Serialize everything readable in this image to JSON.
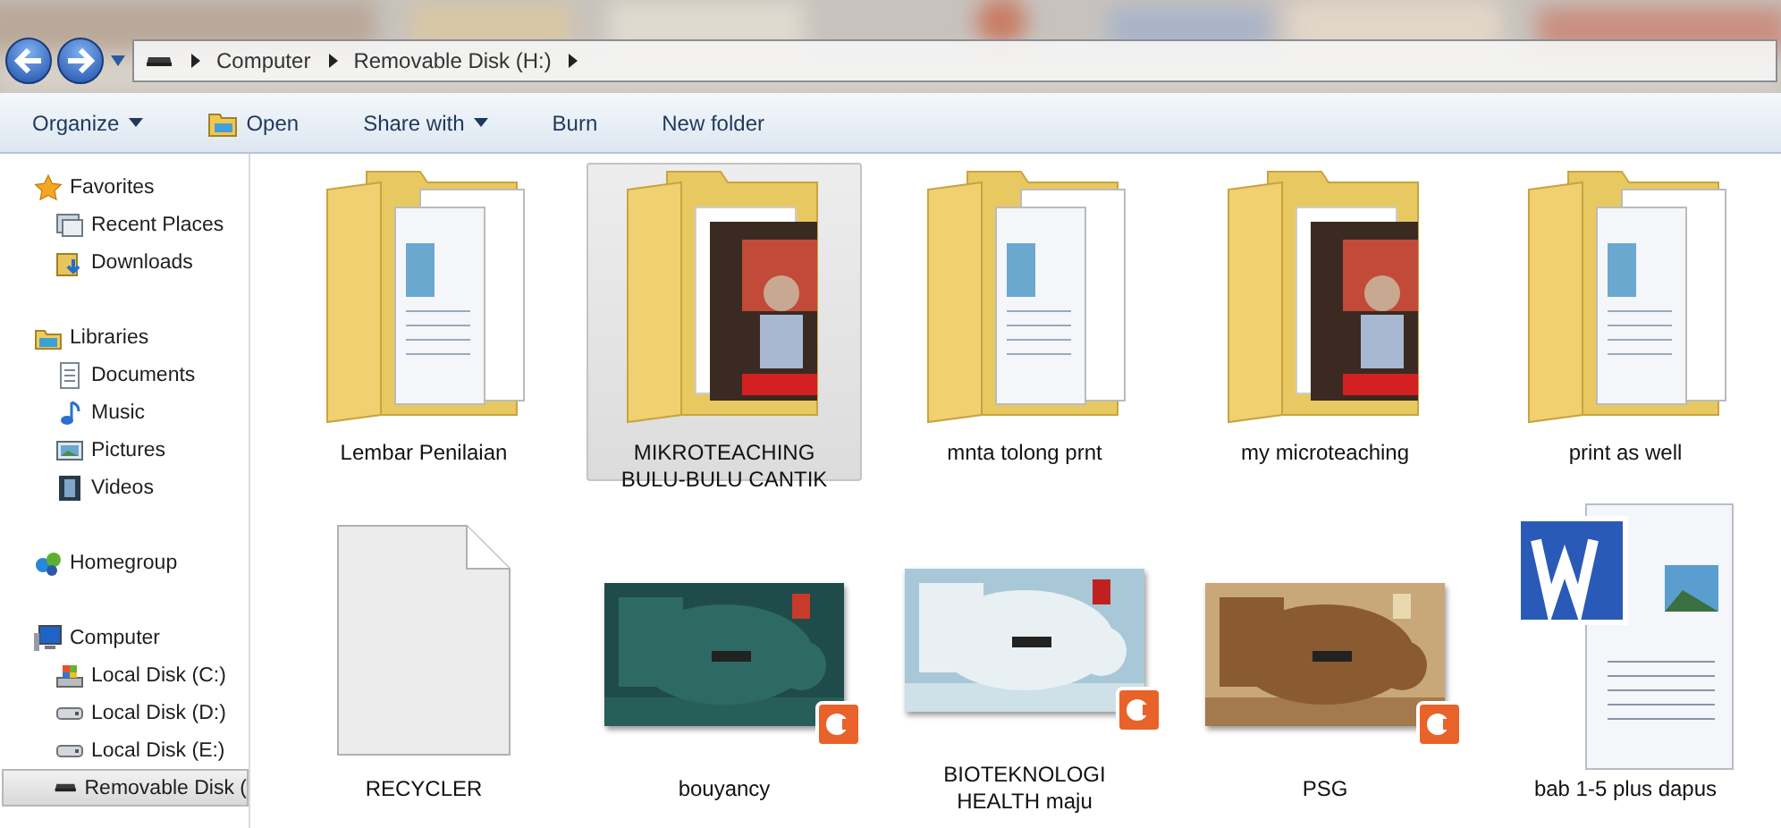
{
  "address_bar": {
    "crumbs": [
      "Computer",
      "Removable Disk (H:)"
    ]
  },
  "toolbar": [
    {
      "label": "Organize",
      "kind": "menu"
    },
    {
      "label": "Open",
      "kind": "icon"
    },
    {
      "label": "Share with",
      "kind": "menu"
    },
    {
      "label": "Burn",
      "kind": "plain"
    },
    {
      "label": "New folder",
      "kind": "plain"
    }
  ],
  "sidebar": [
    {
      "label": "Favorites",
      "children": [
        {
          "label": "Recent Places",
          "selected": false
        },
        {
          "label": "Downloads",
          "selected": false
        }
      ]
    },
    {
      "label": "Libraries",
      "children": [
        {
          "label": "Documents",
          "selected": false
        },
        {
          "label": "Music",
          "selected": false
        },
        {
          "label": "Pictures",
          "selected": false
        },
        {
          "label": "Videos",
          "selected": false
        }
      ]
    },
    {
      "label": "Homegroup"
    },
    {
      "label": "Computer",
      "children": [
        {
          "label": "Local Disk (C:)",
          "selected": false
        },
        {
          "label": "Local Disk (D:)",
          "selected": false
        },
        {
          "label": "Local Disk (E:)",
          "selected": false
        },
        {
          "label": "Removable Disk (",
          "selected": true
        }
      ]
    }
  ],
  "items": [
    {
      "name": "Lembar Penilaian",
      "kind": "folder",
      "selected": false
    },
    {
      "name": "MIKROTEACHING BULU-BULU CANTIK",
      "kind": "photo-folder",
      "selected": true
    },
    {
      "name": "mnta tolong prnt",
      "kind": "folder",
      "selected": false
    },
    {
      "name": "my microteaching",
      "kind": "photo-folder",
      "selected": false
    },
    {
      "name": "print as well",
      "kind": "folder",
      "selected": false
    },
    {
      "name": "RECYCLER",
      "kind": "blank",
      "selected": false
    },
    {
      "name": "bouyancy",
      "kind": "slide",
      "selected": false
    },
    {
      "name": "BIOTEKNOLOGI HEALTH maju",
      "kind": "slide",
      "selected": false
    },
    {
      "name": "PSG",
      "kind": "slide",
      "selected": false
    },
    {
      "name": "bab 1-5 plus dapus",
      "kind": "word",
      "selected": false
    }
  ]
}
